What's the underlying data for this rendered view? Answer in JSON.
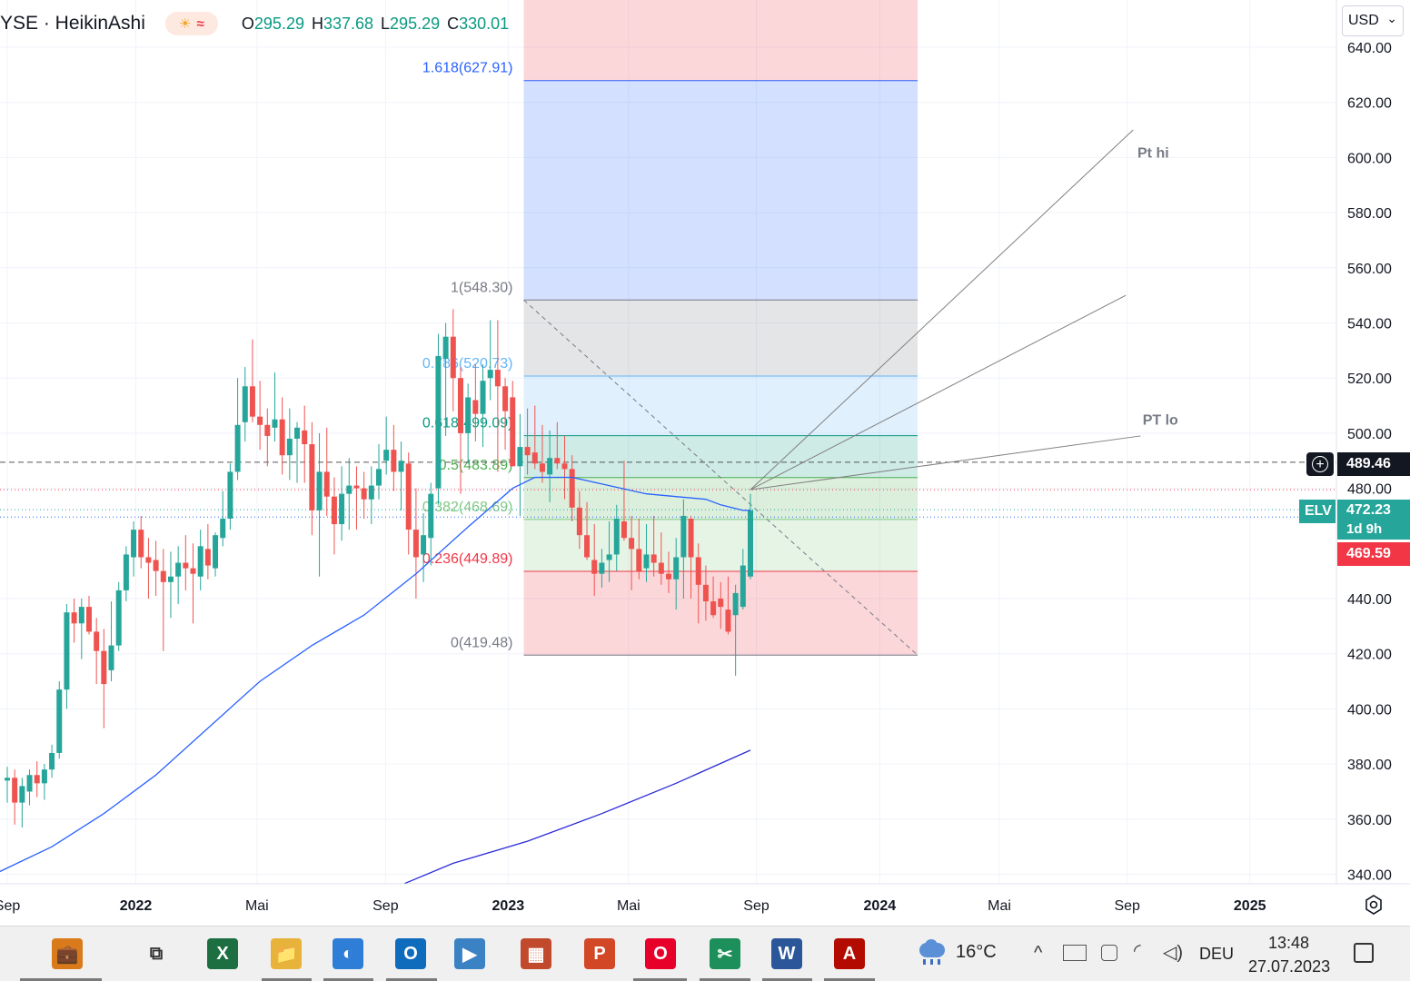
{
  "header": {
    "symbol": "YSE · HeikinAshi",
    "weather_sun": "☀",
    "weather_wave": "≈",
    "o_label": "O",
    "o_value": "295.29",
    "h_label": "H",
    "h_value": "337.68",
    "l_label": "L",
    "l_value": "295.29",
    "c_label": "C",
    "c_value": "330.01"
  },
  "currency": {
    "label": "USD",
    "chevron": "⌄"
  },
  "price_badges": {
    "crosshair_price": "489.46",
    "symbol_tag": "ELV",
    "last_price": "472.23",
    "countdown": "1d 9h",
    "sma_price": "469.59"
  },
  "chart_data": {
    "type": "candlestick",
    "style": "HeikinAshi",
    "timeframe": "weekly",
    "ylim": [
      335,
      647
    ],
    "y_ticks": [
      "640.00",
      "620.00",
      "600.00",
      "580.00",
      "560.00",
      "540.00",
      "520.00",
      "500.00",
      "480.00",
      "440.00",
      "420.00",
      "400.00",
      "380.00",
      "360.00",
      "340.00"
    ],
    "x_ticks": [
      {
        "label": "Sep",
        "t": 0.0
      },
      {
        "label": "2022",
        "t": 17.3
      },
      {
        "label": "Mai",
        "t": 33.6
      },
      {
        "label": "Sep",
        "t": 50.9
      },
      {
        "label": "2023",
        "t": 67.4
      },
      {
        "label": "Mai",
        "t": 83.6
      },
      {
        "label": "Sep",
        "t": 100.8
      },
      {
        "label": "2024",
        "t": 117.4
      },
      {
        "label": "Mai",
        "t": 133.5
      },
      {
        "label": "Sep",
        "t": 150.7
      },
      {
        "label": "2025",
        "t": 167.2
      }
    ],
    "candles": [
      {
        "t": 0.0,
        "o": 374,
        "h": 379,
        "l": 366,
        "c": 375
      },
      {
        "t": 1.0,
        "o": 375,
        "h": 378,
        "l": 358,
        "c": 366
      },
      {
        "t": 2.0,
        "o": 366,
        "h": 375,
        "l": 357,
        "c": 372
      },
      {
        "t": 3.0,
        "o": 370,
        "h": 378,
        "l": 365,
        "c": 376
      },
      {
        "t": 4.0,
        "o": 376,
        "h": 381,
        "l": 368,
        "c": 373
      },
      {
        "t": 5.0,
        "o": 373,
        "h": 380,
        "l": 367,
        "c": 378
      },
      {
        "t": 6.0,
        "o": 378,
        "h": 387,
        "l": 375,
        "c": 384
      },
      {
        "t": 7.0,
        "o": 384,
        "h": 410,
        "l": 382,
        "c": 407
      },
      {
        "t": 8.0,
        "o": 407,
        "h": 438,
        "l": 400,
        "c": 435
      },
      {
        "t": 9.0,
        "o": 435,
        "h": 440,
        "l": 424,
        "c": 431
      },
      {
        "t": 10.0,
        "o": 431,
        "h": 440,
        "l": 418,
        "c": 437
      },
      {
        "t": 11.0,
        "o": 437,
        "h": 441,
        "l": 427,
        "c": 428
      },
      {
        "t": 12.0,
        "o": 428,
        "h": 433,
        "l": 409,
        "c": 421
      },
      {
        "t": 13.0,
        "o": 421,
        "h": 429,
        "l": 393,
        "c": 409
      },
      {
        "t": 14.0,
        "o": 414,
        "h": 439,
        "l": 410,
        "c": 423
      },
      {
        "t": 15.0,
        "o": 423,
        "h": 446,
        "l": 421,
        "c": 443
      },
      {
        "t": 16.0,
        "o": 443,
        "h": 459,
        "l": 439,
        "c": 456
      },
      {
        "t": 17.0,
        "o": 455,
        "h": 468,
        "l": 448,
        "c": 465
      },
      {
        "t": 18.0,
        "o": 465,
        "h": 470,
        "l": 451,
        "c": 455
      },
      {
        "t": 19.0,
        "o": 455,
        "h": 462,
        "l": 440,
        "c": 453
      },
      {
        "t": 20.0,
        "o": 454,
        "h": 461,
        "l": 441,
        "c": 450
      },
      {
        "t": 21.0,
        "o": 450,
        "h": 458,
        "l": 421,
        "c": 446
      },
      {
        "t": 22.0,
        "o": 446,
        "h": 457,
        "l": 433,
        "c": 448
      },
      {
        "t": 23.0,
        "o": 448,
        "h": 459,
        "l": 438,
        "c": 453
      },
      {
        "t": 24.0,
        "o": 453,
        "h": 463,
        "l": 443,
        "c": 451
      },
      {
        "t": 25.0,
        "o": 451,
        "h": 460,
        "l": 431,
        "c": 449
      },
      {
        "t": 26.0,
        "o": 448,
        "h": 465,
        "l": 443,
        "c": 459
      },
      {
        "t": 27.0,
        "o": 458,
        "h": 467,
        "l": 447,
        "c": 452
      },
      {
        "t": 28.0,
        "o": 451,
        "h": 464,
        "l": 448,
        "c": 463
      },
      {
        "t": 29.0,
        "o": 462,
        "h": 479,
        "l": 459,
        "c": 469
      },
      {
        "t": 30.0,
        "o": 469,
        "h": 489,
        "l": 465,
        "c": 486
      },
      {
        "t": 31.0,
        "o": 486,
        "h": 520,
        "l": 483,
        "c": 503
      },
      {
        "t": 32.0,
        "o": 504,
        "h": 524,
        "l": 497,
        "c": 517
      },
      {
        "t": 33.0,
        "o": 517,
        "h": 534,
        "l": 504,
        "c": 506
      },
      {
        "t": 34.0,
        "o": 506,
        "h": 519,
        "l": 494,
        "c": 503
      },
      {
        "t": 35.0,
        "o": 503,
        "h": 509,
        "l": 488,
        "c": 499
      },
      {
        "t": 36.0,
        "o": 502,
        "h": 522,
        "l": 497,
        "c": 505
      },
      {
        "t": 37.0,
        "o": 505,
        "h": 513,
        "l": 485,
        "c": 492
      },
      {
        "t": 38.0,
        "o": 492,
        "h": 509,
        "l": 483,
        "c": 498
      },
      {
        "t": 39.0,
        "o": 498,
        "h": 504,
        "l": 482,
        "c": 502
      },
      {
        "t": 40.0,
        "o": 501,
        "h": 510,
        "l": 482,
        "c": 496
      },
      {
        "t": 41.0,
        "o": 496,
        "h": 504,
        "l": 463,
        "c": 472
      },
      {
        "t": 42.0,
        "o": 472,
        "h": 500,
        "l": 448,
        "c": 486
      },
      {
        "t": 43.0,
        "o": 486,
        "h": 502,
        "l": 470,
        "c": 477
      },
      {
        "t": 44.0,
        "o": 477,
        "h": 484,
        "l": 456,
        "c": 467
      },
      {
        "t": 45.0,
        "o": 467,
        "h": 488,
        "l": 461,
        "c": 478
      },
      {
        "t": 46.0,
        "o": 478,
        "h": 491,
        "l": 465,
        "c": 481
      },
      {
        "t": 47.0,
        "o": 481,
        "h": 488,
        "l": 465,
        "c": 480
      },
      {
        "t": 48.0,
        "o": 480,
        "h": 486,
        "l": 469,
        "c": 476
      },
      {
        "t": 49.0,
        "o": 476,
        "h": 488,
        "l": 467,
        "c": 481
      },
      {
        "t": 50.0,
        "o": 481,
        "h": 496,
        "l": 476,
        "c": 487
      },
      {
        "t": 51.0,
        "o": 490,
        "h": 506,
        "l": 485,
        "c": 494
      },
      {
        "t": 52.0,
        "o": 494,
        "h": 503,
        "l": 479,
        "c": 486
      },
      {
        "t": 53.0,
        "o": 486,
        "h": 497,
        "l": 472,
        "c": 490
      },
      {
        "t": 54.0,
        "o": 489,
        "h": 493,
        "l": 456,
        "c": 465
      },
      {
        "t": 55.0,
        "o": 465,
        "h": 480,
        "l": 440,
        "c": 455
      },
      {
        "t": 56.0,
        "o": 456,
        "h": 471,
        "l": 446,
        "c": 463
      },
      {
        "t": 57.0,
        "o": 462,
        "h": 482,
        "l": 452,
        "c": 478
      },
      {
        "t": 58.0,
        "o": 480,
        "h": 536,
        "l": 474,
        "c": 528
      },
      {
        "t": 59.0,
        "o": 527,
        "h": 540,
        "l": 499,
        "c": 535
      },
      {
        "t": 60.0,
        "o": 535,
        "h": 545,
        "l": 508,
        "c": 520
      },
      {
        "t": 61.0,
        "o": 520,
        "h": 524,
        "l": 478,
        "c": 500
      },
      {
        "t": 62.0,
        "o": 500,
        "h": 518,
        "l": 489,
        "c": 513
      },
      {
        "t": 63.0,
        "o": 512,
        "h": 525,
        "l": 497,
        "c": 507
      },
      {
        "t": 64.0,
        "o": 507,
        "h": 525,
        "l": 495,
        "c": 519
      },
      {
        "t": 65.0,
        "o": 520,
        "h": 541,
        "l": 512,
        "c": 523
      },
      {
        "t": 66.0,
        "o": 523,
        "h": 541,
        "l": 486,
        "c": 517
      },
      {
        "t": 67.0,
        "o": 517,
        "h": 520,
        "l": 494,
        "c": 508
      },
      {
        "t": 68.0,
        "o": 513,
        "h": 519,
        "l": 489,
        "c": 488
      },
      {
        "t": 69.0,
        "o": 488,
        "h": 507,
        "l": 470,
        "c": 495
      },
      {
        "t": 70.0,
        "o": 495,
        "h": 509,
        "l": 485,
        "c": 492
      },
      {
        "t": 71.0,
        "o": 493,
        "h": 510,
        "l": 487,
        "c": 489
      },
      {
        "t": 72.0,
        "o": 489,
        "h": 503,
        "l": 482,
        "c": 486
      },
      {
        "t": 73.0,
        "o": 485,
        "h": 501,
        "l": 475,
        "c": 491
      },
      {
        "t": 74.0,
        "o": 491,
        "h": 504,
        "l": 487,
        "c": 489
      },
      {
        "t": 75.0,
        "o": 489,
        "h": 499,
        "l": 476,
        "c": 487
      },
      {
        "t": 76.0,
        "o": 487,
        "h": 492,
        "l": 468,
        "c": 473
      },
      {
        "t": 77.0,
        "o": 473,
        "h": 479,
        "l": 458,
        "c": 463
      },
      {
        "t": 78.0,
        "o": 463,
        "h": 475,
        "l": 454,
        "c": 455
      },
      {
        "t": 79.0,
        "o": 454,
        "h": 467,
        "l": 441,
        "c": 449
      },
      {
        "t": 80.0,
        "o": 449,
        "h": 458,
        "l": 444,
        "c": 453
      },
      {
        "t": 81.0,
        "o": 454,
        "h": 468,
        "l": 446,
        "c": 456
      },
      {
        "t": 82.0,
        "o": 456,
        "h": 474,
        "l": 450,
        "c": 469
      },
      {
        "t": 83.0,
        "o": 468,
        "h": 490,
        "l": 461,
        "c": 462
      },
      {
        "t": 84.0,
        "o": 462,
        "h": 470,
        "l": 443,
        "c": 458
      },
      {
        "t": 85.0,
        "o": 458,
        "h": 469,
        "l": 447,
        "c": 450
      },
      {
        "t": 86.0,
        "o": 451,
        "h": 467,
        "l": 446,
        "c": 456
      },
      {
        "t": 87.0,
        "o": 456,
        "h": 470,
        "l": 448,
        "c": 453
      },
      {
        "t": 88.0,
        "o": 453,
        "h": 464,
        "l": 445,
        "c": 449
      },
      {
        "t": 89.0,
        "o": 449,
        "h": 457,
        "l": 442,
        "c": 447
      },
      {
        "t": 90.0,
        "o": 447,
        "h": 462,
        "l": 436,
        "c": 455
      },
      {
        "t": 91.0,
        "o": 455,
        "h": 476,
        "l": 440,
        "c": 470
      },
      {
        "t": 92.0,
        "o": 469,
        "h": 470,
        "l": 440,
        "c": 455
      },
      {
        "t": 93.0,
        "o": 455,
        "h": 460,
        "l": 431,
        "c": 445
      },
      {
        "t": 94.0,
        "o": 445,
        "h": 452,
        "l": 432,
        "c": 439
      },
      {
        "t": 95.0,
        "o": 439,
        "h": 448,
        "l": 433,
        "c": 434
      },
      {
        "t": 96.0,
        "o": 440,
        "h": 446,
        "l": 429,
        "c": 437
      },
      {
        "t": 97.0,
        "o": 436,
        "h": 448,
        "l": 427,
        "c": 428
      },
      {
        "t": 98.0,
        "o": 434,
        "h": 445,
        "l": 412,
        "c": 442
      },
      {
        "t": 99.0,
        "o": 437,
        "h": 458,
        "l": 436,
        "c": 452
      },
      {
        "t": 100.0,
        "o": 448,
        "h": 478,
        "l": 447,
        "c": 472
      }
    ],
    "ma_50": [
      [
        -1,
        341
      ],
      [
        6,
        350
      ],
      [
        13,
        362
      ],
      [
        20,
        376
      ],
      [
        27,
        393
      ],
      [
        34,
        410
      ],
      [
        41,
        423
      ],
      [
        48,
        434
      ],
      [
        55,
        449
      ],
      [
        62,
        466
      ],
      [
        68,
        480
      ],
      [
        71,
        484
      ],
      [
        76,
        484
      ],
      [
        81,
        481
      ],
      [
        86,
        478
      ],
      [
        90,
        477
      ],
      [
        94,
        476
      ],
      [
        96,
        474
      ],
      [
        99,
        472
      ],
      [
        100,
        472
      ]
    ],
    "ma_200": [
      [
        52,
        335
      ],
      [
        60,
        344
      ],
      [
        70,
        352
      ],
      [
        80,
        362
      ],
      [
        90,
        373
      ],
      [
        100,
        385
      ]
    ],
    "fibonacci": {
      "t_start": 69.5,
      "t_end": 122.5,
      "levels": [
        {
          "ratio": "1.618",
          "price": 627.91,
          "label": "1.618(627.91)",
          "color": "#2962ff"
        },
        {
          "ratio": "1",
          "price": 548.3,
          "label": "1(548.30)",
          "color": "#787b86"
        },
        {
          "ratio": "0.786",
          "price": 520.73,
          "label": "0.786(520.73)",
          "color": "#64b5f6"
        },
        {
          "ratio": "0.618",
          "price": 499.09,
          "label": "0.618(499.09)",
          "color": "#089981"
        },
        {
          "ratio": "0.5",
          "price": 483.89,
          "label": "0.5(483.89)",
          "color": "#4caf50"
        },
        {
          "ratio": "0.382",
          "price": 468.69,
          "label": "0.382(468.69)",
          "color": "#81c784"
        },
        {
          "ratio": "0.236",
          "price": 449.89,
          "label": "0.236(449.89)",
          "color": "#f23645"
        },
        {
          "ratio": "0",
          "price": 419.48,
          "label": "0(419.48)",
          "color": "#787b86"
        }
      ]
    },
    "fan": {
      "origin": {
        "t": 100.0,
        "price": 479.5
      },
      "rays": [
        {
          "t": 151.5,
          "price": 610
        },
        {
          "t": 150.5,
          "price": 550
        },
        {
          "t": 152.5,
          "price": 499
        }
      ]
    },
    "annotations": [
      {
        "text": "Pt hi",
        "t": 150.0,
        "price": 602
      },
      {
        "text": "PT lo",
        "t": 150.7,
        "price": 505
      }
    ],
    "hlines": [
      {
        "price": 489.46,
        "style": "dashed",
        "color": "#555555"
      },
      {
        "price": 479.5,
        "style": "dotted",
        "color": "#f23645"
      },
      {
        "price": 472.23,
        "style": "dotted",
        "color": "#26a69a"
      },
      {
        "price": 469.59,
        "style": "dotted",
        "color": "#2962ff"
      }
    ]
  },
  "taskbar": {
    "items": [
      {
        "name": "briefcase-app-icon",
        "glyph": "💼"
      },
      {
        "name": "task-view-icon",
        "glyph": "⧉"
      },
      {
        "name": "excel-icon",
        "glyph": "X"
      },
      {
        "name": "file-explorer-icon",
        "glyph": "📁"
      },
      {
        "name": "edge-icon",
        "glyph": "◐"
      },
      {
        "name": "outlook-icon",
        "glyph": "O"
      },
      {
        "name": "media-player-icon",
        "glyph": "▶"
      },
      {
        "name": "device-icon",
        "glyph": "▦"
      },
      {
        "name": "powerpoint-icon",
        "glyph": "P"
      },
      {
        "name": "opera-icon",
        "glyph": "O"
      },
      {
        "name": "app-icon",
        "glyph": "✂"
      },
      {
        "name": "word-icon",
        "glyph": "W"
      },
      {
        "name": "acrobat-icon",
        "glyph": "A"
      }
    ],
    "weather_temp": "16°C",
    "language": "DEU",
    "time": "13:48",
    "date": "27.07.2023"
  }
}
